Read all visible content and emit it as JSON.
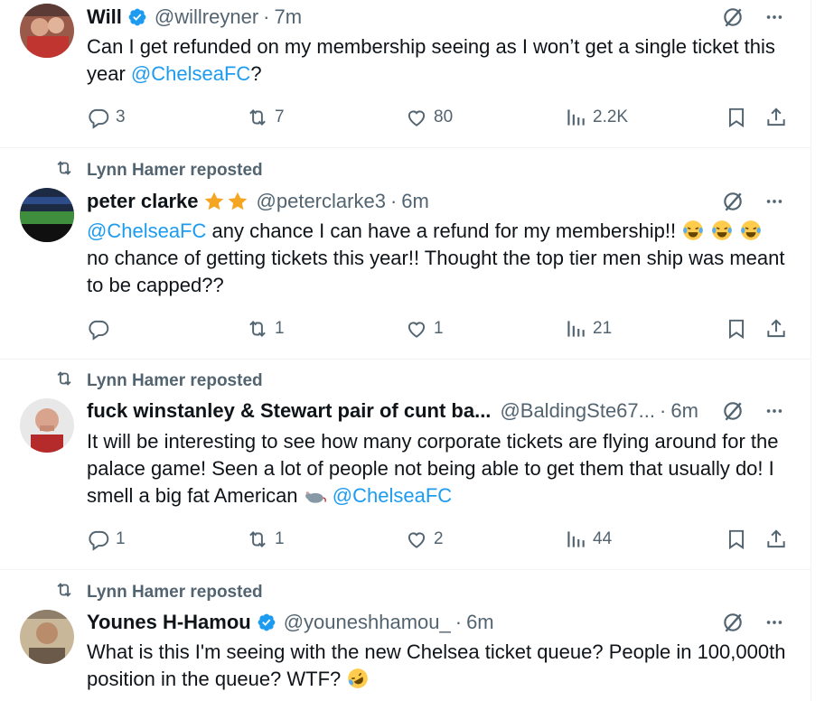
{
  "tweets": [
    {
      "reposted_by": "",
      "name": "Will",
      "verified": true,
      "handle": "@willreyner",
      "time": "7m",
      "text_parts": [
        "Can I get refunded on my membership seeing as I won’t get a single ticket this year ",
        "@ChelseaFC",
        "?"
      ],
      "replies": "3",
      "reposts": "7",
      "likes": "80",
      "views": "2.2K"
    },
    {
      "reposted_by": "Lynn Hamer reposted",
      "name": "peter clarke",
      "verified": false,
      "handle": "@peterclarke3",
      "time": "6m",
      "text_parts": [
        "@ChelseaFC",
        " any chance I can have a refund for my membership!! ",
        "no chance of getting tickets this year!! Thought the top tier men ship was meant to be capped??"
      ],
      "replies": "",
      "reposts": "1",
      "likes": "1",
      "views": "21"
    },
    {
      "reposted_by": "Lynn Hamer reposted",
      "name": "fuck winstanley & Stewart pair of cunt ba...",
      "verified": false,
      "handle": "@BaldingSte67...",
      "time": "6m",
      "text_parts": [
        "It will be interesting to see how many corporate tickets are flying around for the palace game! Seen a lot of people not being able to get them that usually do! I smell a big fat American ",
        "@ChelseaFC"
      ],
      "replies": "1",
      "reposts": "1",
      "likes": "2",
      "views": "44"
    },
    {
      "reposted_by": "Lynn Hamer reposted",
      "name": "Younes H-Hamou",
      "verified": true,
      "handle": "@youneshhamou_",
      "time": "6m",
      "text_parts": [
        "What is this I'm seeing with the new Chelsea ticket queue? People in 100,000th position in the queue? WTF? "
      ]
    }
  ],
  "separator": "·",
  "icons": {
    "reply": "reply-icon",
    "repost": "repost-icon",
    "like": "heart-icon",
    "views": "views-icon",
    "bookmark": "bookmark-icon",
    "share": "share-icon",
    "grok": "grok-icon",
    "more": "more-icon",
    "verified": "verified-badge-icon"
  },
  "colors": {
    "link": "#1d9bf0",
    "muted": "#536471",
    "text": "#0f1419",
    "verified": "#1d9bf0",
    "star": "#f4a623"
  }
}
